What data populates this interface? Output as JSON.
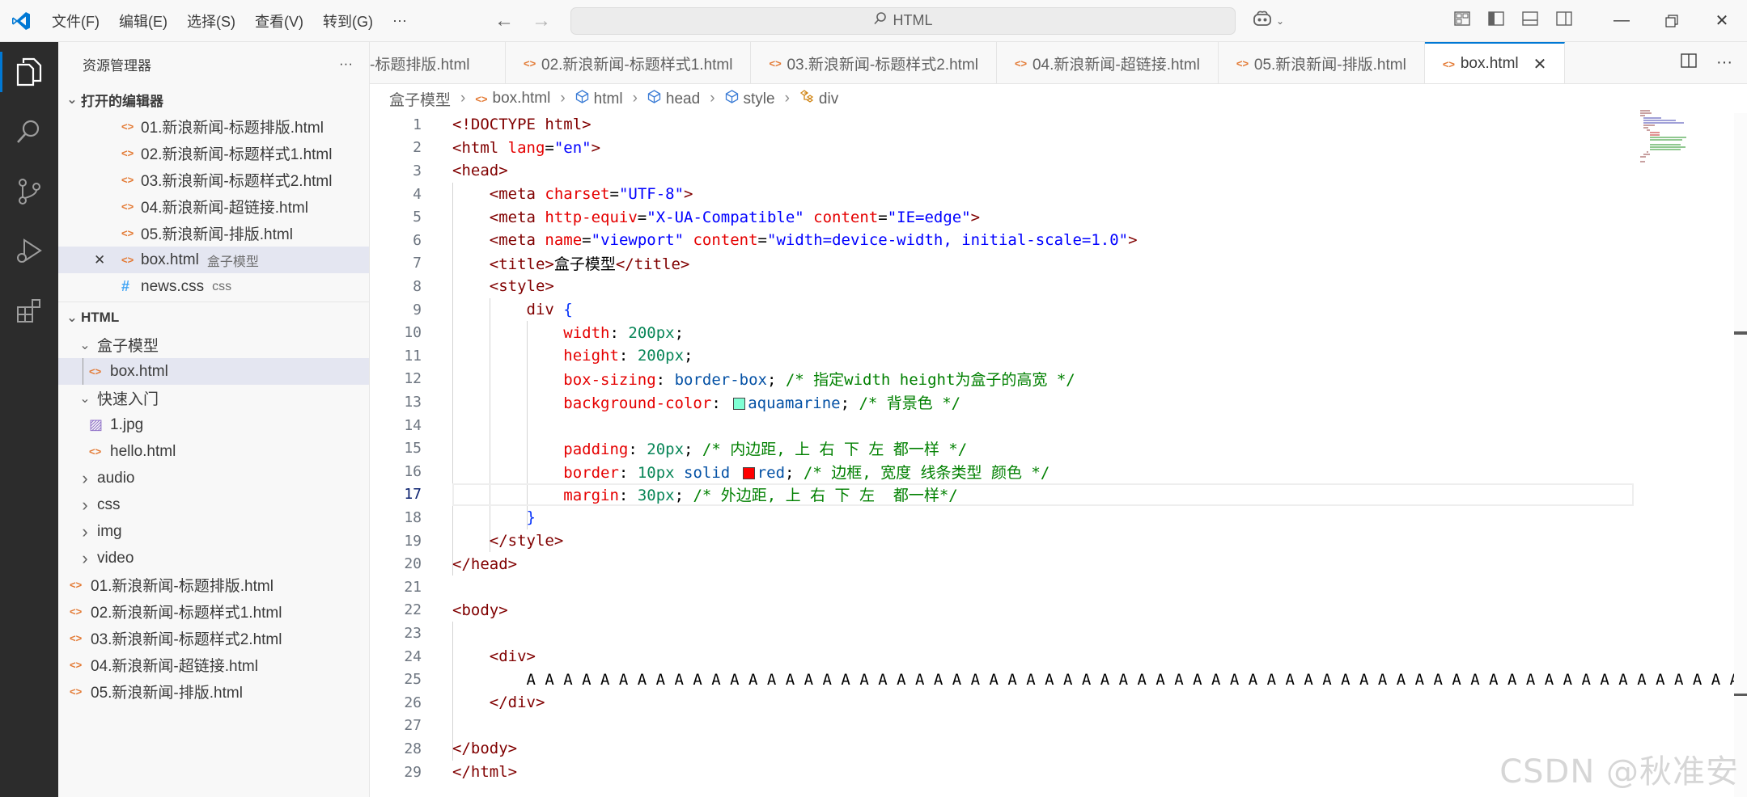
{
  "titlebar": {
    "menus": [
      "文件(F)",
      "编辑(E)",
      "选择(S)",
      "查看(V)",
      "转到(G)"
    ],
    "more": "···",
    "command_center": "HTML"
  },
  "sidebar": {
    "title": "资源管理器",
    "more": "···",
    "open_editors_header": "打开的编辑器",
    "open_editors": [
      {
        "name": "01.新浪新闻-标题排版.html",
        "type": "html"
      },
      {
        "name": "02.新浪新闻-标题样式1.html",
        "type": "html"
      },
      {
        "name": "03.新浪新闻-标题样式2.html",
        "type": "html"
      },
      {
        "name": "04.新浪新闻-超链接.html",
        "type": "html"
      },
      {
        "name": "05.新浪新闻-排版.html",
        "type": "html"
      },
      {
        "name": "box.html",
        "desc": "盒子模型",
        "type": "html"
      },
      {
        "name": "news.css",
        "desc": "css",
        "type": "css"
      }
    ],
    "workspace_header": "HTML",
    "tree": [
      {
        "name": "盒子模型",
        "kind": "folder-open",
        "depth": 1
      },
      {
        "name": "box.html",
        "kind": "html",
        "depth": 2
      },
      {
        "name": "快速入门",
        "kind": "folder-open",
        "depth": 1
      },
      {
        "name": "1.jpg",
        "kind": "image",
        "depth": 2
      },
      {
        "name": "hello.html",
        "kind": "html",
        "depth": 2
      },
      {
        "name": "audio",
        "kind": "folder",
        "depth": 1
      },
      {
        "name": "css",
        "kind": "folder",
        "depth": 1
      },
      {
        "name": "img",
        "kind": "folder",
        "depth": 1
      },
      {
        "name": "video",
        "kind": "folder",
        "depth": 1
      },
      {
        "name": "01.新浪新闻-标题排版.html",
        "kind": "html",
        "depth": 0
      },
      {
        "name": "02.新浪新闻-标题样式1.html",
        "kind": "html",
        "depth": 0
      },
      {
        "name": "03.新浪新闻-标题样式2.html",
        "kind": "html",
        "depth": 0
      },
      {
        "name": "04.新浪新闻-超链接.html",
        "kind": "html",
        "depth": 0
      },
      {
        "name": "05.新浪新闻-排版.html",
        "kind": "html",
        "depth": 0
      }
    ]
  },
  "tabs": [
    {
      "label": "-标题排版.html",
      "active": false
    },
    {
      "label": "02.新浪新闻-标题样式1.html",
      "active": false
    },
    {
      "label": "03.新浪新闻-标题样式2.html",
      "active": false
    },
    {
      "label": "04.新浪新闻-超链接.html",
      "active": false
    },
    {
      "label": "05.新浪新闻-排版.html",
      "active": false
    },
    {
      "label": "box.html",
      "active": true
    }
  ],
  "breadcrumb": [
    "盒子模型",
    "box.html",
    "html",
    "head",
    "style",
    "div"
  ],
  "editor": {
    "current_line": 17,
    "lines": [
      [
        [
          "t-tag",
          "<!DOCTYPE html>"
        ]
      ],
      [
        [
          "t-tag",
          "<html "
        ],
        [
          "t-attr",
          "lang"
        ],
        [
          "t-punc",
          "="
        ],
        [
          "t-str",
          "\"en\""
        ],
        [
          "t-tag",
          ">"
        ]
      ],
      [
        [
          "t-tag",
          "<head>"
        ]
      ],
      [
        [
          "t-text",
          "    "
        ],
        [
          "t-tag",
          "<meta "
        ],
        [
          "t-attr",
          "charset"
        ],
        [
          "t-punc",
          "="
        ],
        [
          "t-str",
          "\"UTF-8\""
        ],
        [
          "t-tag",
          ">"
        ]
      ],
      [
        [
          "t-text",
          "    "
        ],
        [
          "t-tag",
          "<meta "
        ],
        [
          "t-attr",
          "http-equiv"
        ],
        [
          "t-punc",
          "="
        ],
        [
          "t-str",
          "\"X-UA-Compatible\""
        ],
        [
          "t-tag",
          " "
        ],
        [
          "t-attr",
          "content"
        ],
        [
          "t-punc",
          "="
        ],
        [
          "t-str",
          "\"IE=edge\""
        ],
        [
          "t-tag",
          ">"
        ]
      ],
      [
        [
          "t-text",
          "    "
        ],
        [
          "t-tag",
          "<meta "
        ],
        [
          "t-attr",
          "name"
        ],
        [
          "t-punc",
          "="
        ],
        [
          "t-str",
          "\"viewport\""
        ],
        [
          "t-tag",
          " "
        ],
        [
          "t-attr",
          "content"
        ],
        [
          "t-punc",
          "="
        ],
        [
          "t-str",
          "\"width=device-width, initial-scale=1.0\""
        ],
        [
          "t-tag",
          ">"
        ]
      ],
      [
        [
          "t-text",
          "    "
        ],
        [
          "t-tag",
          "<title>"
        ],
        [
          "t-text",
          "盒子模型"
        ],
        [
          "t-tag",
          "</title>"
        ]
      ],
      [
        [
          "t-text",
          "    "
        ],
        [
          "t-tag",
          "<style>"
        ]
      ],
      [
        [
          "t-text",
          "        "
        ],
        [
          "t-sel",
          "div"
        ],
        [
          "t-punc",
          " "
        ],
        [
          "t-brace",
          "{"
        ]
      ],
      [
        [
          "t-text",
          "            "
        ],
        [
          "t-prop",
          "width"
        ],
        [
          "t-punc",
          ": "
        ],
        [
          "t-num",
          "200px"
        ],
        [
          "t-punc",
          ";"
        ]
      ],
      [
        [
          "t-text",
          "            "
        ],
        [
          "t-prop",
          "height"
        ],
        [
          "t-punc",
          ": "
        ],
        [
          "t-num",
          "200px"
        ],
        [
          "t-punc",
          ";"
        ]
      ],
      [
        [
          "t-text",
          "            "
        ],
        [
          "t-prop",
          "box-sizing"
        ],
        [
          "t-punc",
          ": "
        ],
        [
          "t-val",
          "border-box"
        ],
        [
          "t-punc",
          "; "
        ],
        [
          "t-com",
          "/* 指定width height为盒子的高宽 */"
        ]
      ],
      [
        [
          "t-text",
          "            "
        ],
        [
          "t-prop",
          "background-color"
        ],
        [
          "t-punc",
          ": "
        ],
        [
          "swatch",
          "#7fffd4"
        ],
        [
          "t-val",
          "aquamarine"
        ],
        [
          "t-punc",
          "; "
        ],
        [
          "t-com",
          "/* 背景色 */"
        ]
      ],
      [],
      [
        [
          "t-text",
          "            "
        ],
        [
          "t-prop",
          "padding"
        ],
        [
          "t-punc",
          ": "
        ],
        [
          "t-num",
          "20px"
        ],
        [
          "t-punc",
          "; "
        ],
        [
          "t-com",
          "/* 内边距, 上 右 下 左 都一样 */"
        ]
      ],
      [
        [
          "t-text",
          "            "
        ],
        [
          "t-prop",
          "border"
        ],
        [
          "t-punc",
          ": "
        ],
        [
          "t-num",
          "10px"
        ],
        [
          "t-punc",
          " "
        ],
        [
          "t-val",
          "solid"
        ],
        [
          "t-punc",
          " "
        ],
        [
          "swatch",
          "#ff0000"
        ],
        [
          "t-val",
          "red"
        ],
        [
          "t-punc",
          "; "
        ],
        [
          "t-com",
          "/* 边框, 宽度 线条类型 颜色 */"
        ]
      ],
      [
        [
          "t-text",
          "            "
        ],
        [
          "t-prop",
          "margin"
        ],
        [
          "t-punc",
          ": "
        ],
        [
          "t-num",
          "30px"
        ],
        [
          "t-punc",
          "; "
        ],
        [
          "t-com",
          "/* 外边距, 上 右 下 左  都一样*/"
        ]
      ],
      [
        [
          "t-text",
          "        "
        ],
        [
          "t-brace",
          "}"
        ]
      ],
      [
        [
          "t-text",
          "    "
        ],
        [
          "t-tag",
          "</style>"
        ]
      ],
      [
        [
          "t-tag",
          "</head>"
        ]
      ],
      [],
      [
        [
          "t-tag",
          "<body>"
        ]
      ],
      [],
      [
        [
          "t-text",
          "    "
        ],
        [
          "t-tag",
          "<div>"
        ]
      ],
      [
        [
          "t-text",
          "        A A A A A A A A A A A A A A A A A A A A A A A A A A A A A A A A A A A A A A A A A A A A A A A A A A A A A A A A A A A A A A A A A A A A A A"
        ]
      ],
      [
        [
          "t-text",
          "    "
        ],
        [
          "t-tag",
          "</div>"
        ]
      ],
      [],
      [
        [
          "t-tag",
          "</body>"
        ]
      ],
      [
        [
          "t-tag",
          "</html>"
        ]
      ]
    ]
  },
  "watermark": "CSDN @秋准安",
  "colors": {
    "accent": "#0078d4",
    "activity_bg": "#2c2c2c",
    "sidebar_bg": "#f8f8f8"
  }
}
